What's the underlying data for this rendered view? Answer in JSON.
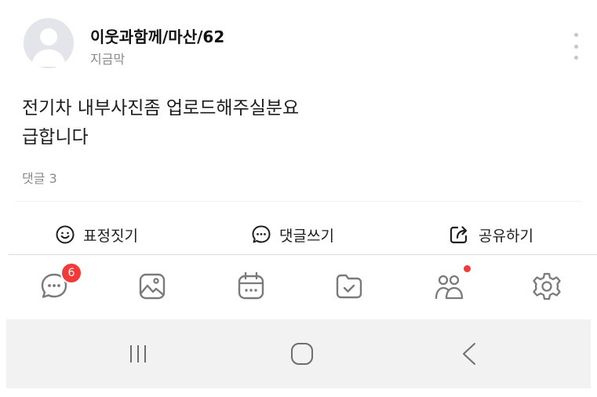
{
  "post": {
    "author": "이웃과함께/마산/62",
    "time": "지금막",
    "body_line1": "전기차 내부사진좀 업로드해주실분요",
    "body_line2": "급합니다",
    "comment_count_label": "댓글 3"
  },
  "actions": {
    "react_label": "표정짓기",
    "comment_label": "댓글쓰기",
    "share_label": "공유하기"
  },
  "tabs": {
    "chat_badge": "6",
    "items": [
      "chat-icon",
      "gallery-icon",
      "calendar-icon",
      "folder-icon",
      "members-icon",
      "settings-icon"
    ]
  },
  "system_nav": [
    "recent-apps-icon",
    "home-icon",
    "back-icon"
  ],
  "colors": {
    "badge": "#f23a3a",
    "icon": "#7a7a7a",
    "nav_background": "#f2f2f2"
  }
}
